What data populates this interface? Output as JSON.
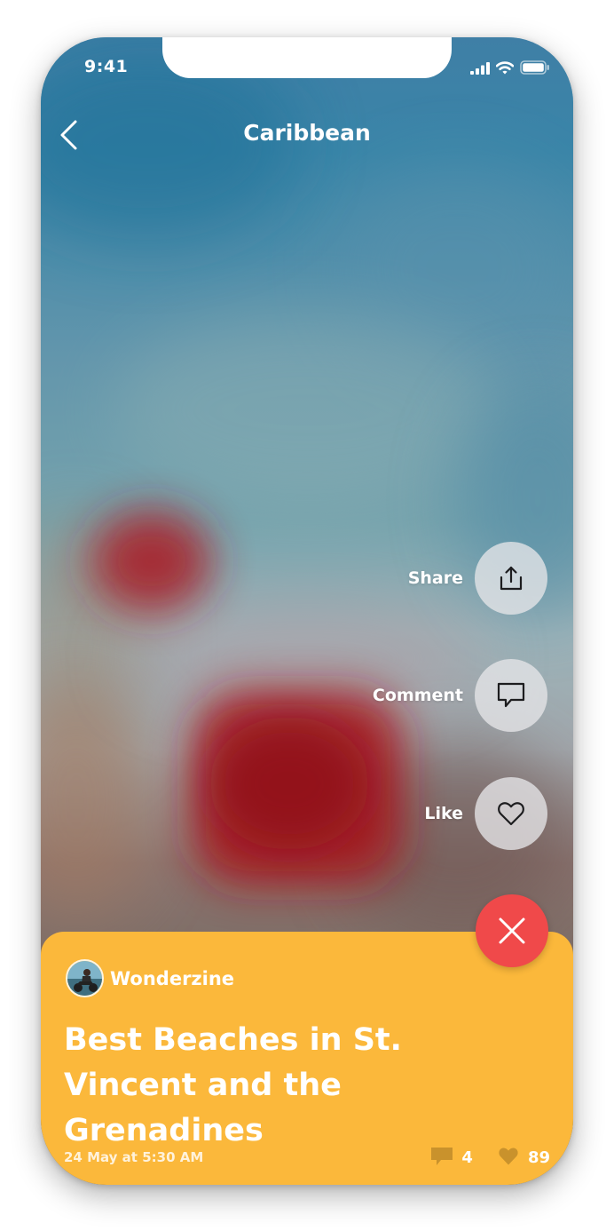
{
  "status_bar": {
    "time": "9:41",
    "icons": [
      "cellular-signal-icon",
      "wifi-icon",
      "battery-icon"
    ]
  },
  "nav": {
    "back_icon": "chevron-left-icon",
    "title": "Caribbean"
  },
  "actions": [
    {
      "label": "Share",
      "icon": "share-icon"
    },
    {
      "label": "Comment",
      "icon": "comment-icon"
    },
    {
      "label": "Like",
      "icon": "heart-icon"
    }
  ],
  "close_button": {
    "icon": "close-icon",
    "color": "#f0494a"
  },
  "card": {
    "background": "#fbb83b",
    "author": "Wonderzine",
    "title": "Best Beaches in St. Vincent and the Grenadines",
    "date": "24 May at 5:30 AM",
    "comments_count": "4",
    "likes_count": "89"
  }
}
